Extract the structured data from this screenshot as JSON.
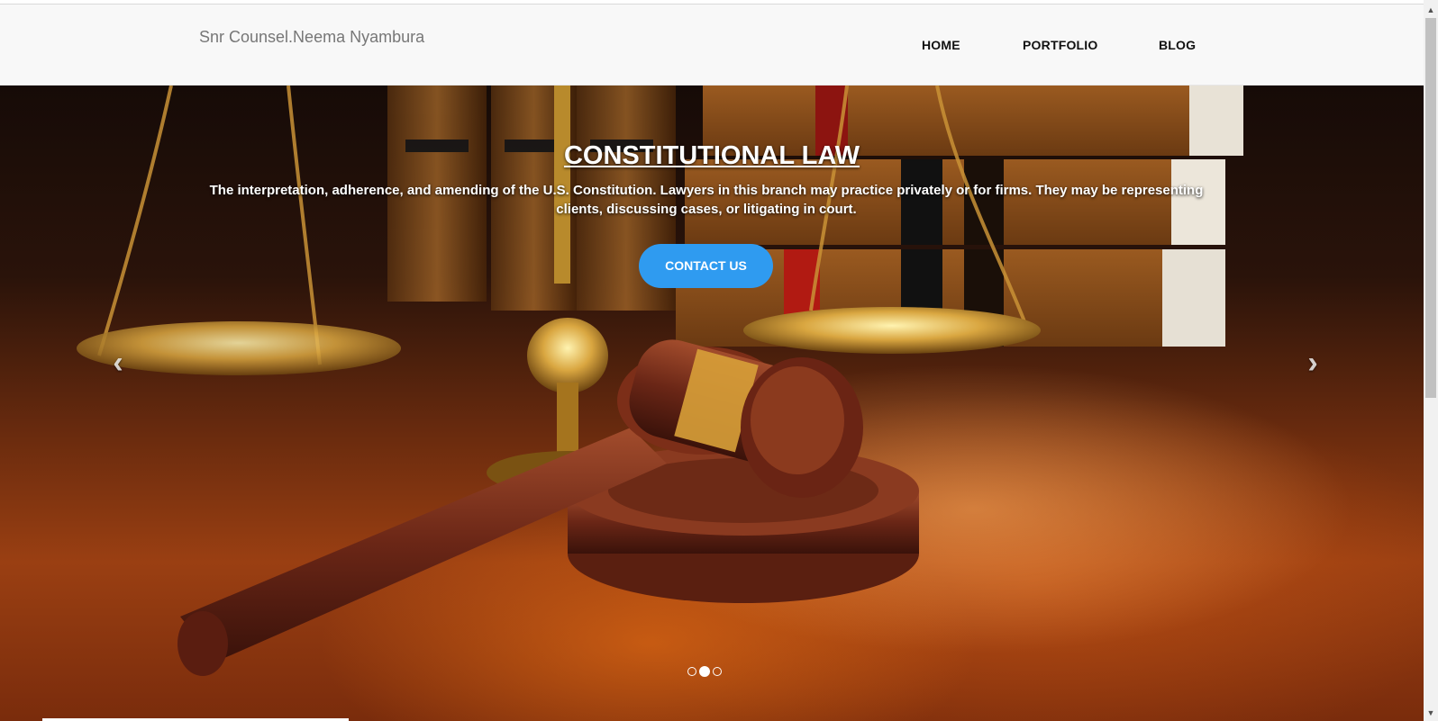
{
  "navbar": {
    "brand": "Snr Counsel.Neema Nyambura",
    "links": [
      "HOME",
      "PORTFOLIO",
      "BLOG"
    ]
  },
  "carousel": {
    "title": "CONSTITUTIONAL LAW",
    "text": "The interpretation, adherence, and amending of the U.S. Constitution. Lawyers in this branch may practice privately or for firms. They may be representing clients, discussing cases, or litigating in court.",
    "button_label": "CONTACT US",
    "prev_icon": "chevron-left-icon",
    "next_icon": "chevron-right-icon",
    "prev_glyph": "‹",
    "next_glyph": "›",
    "slide_count": 3,
    "active_slide": 2,
    "background_image": "gavel-and-scales-of-justice-on-desk"
  },
  "scrollbar": {
    "up_glyph": "▲",
    "down_glyph": "▼"
  },
  "colors": {
    "navbar_bg": "#f8f8f8",
    "brand_text": "#777777",
    "button_bg": "#2f9bf0",
    "hero_text": "#ffffff"
  }
}
